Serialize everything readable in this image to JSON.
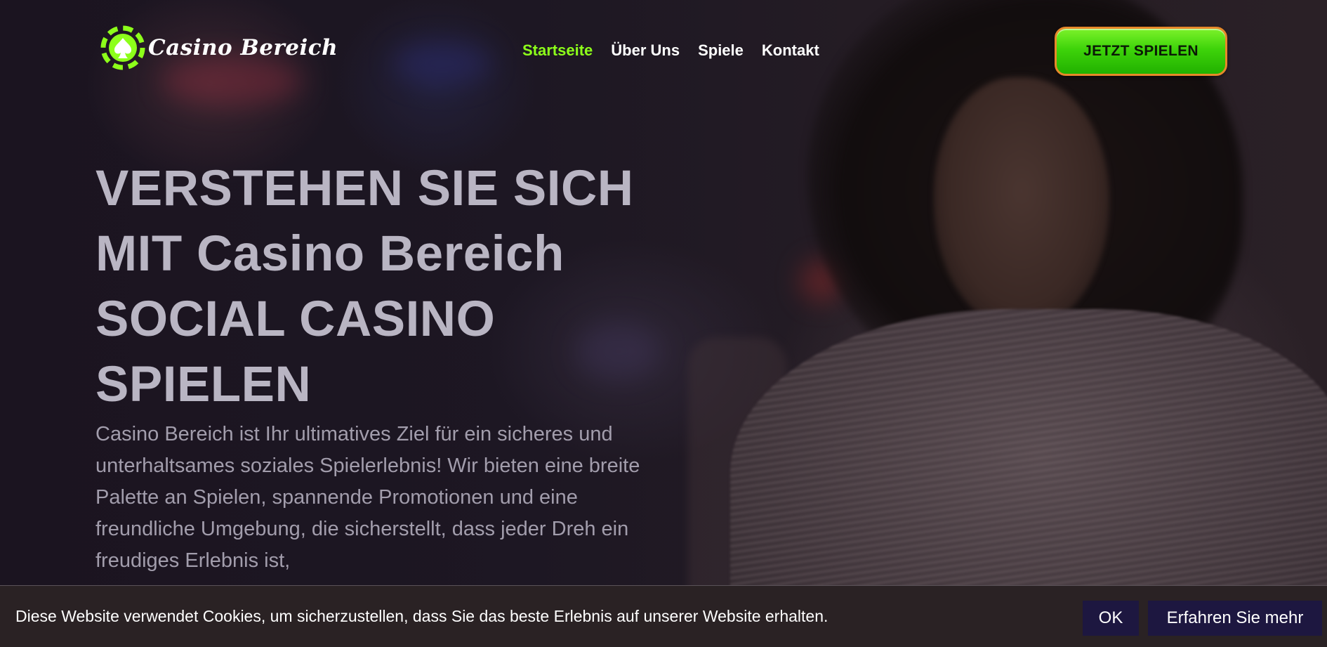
{
  "header": {
    "logo_text": "Casino Bereich",
    "nav": [
      {
        "label": "Startseite",
        "active": true
      },
      {
        "label": "Über Uns",
        "active": false
      },
      {
        "label": "Spiele",
        "active": false
      },
      {
        "label": "Kontakt",
        "active": false
      }
    ],
    "cta_label": "JETZT SPIELEN"
  },
  "hero": {
    "title_lines": [
      "VERSTEHEN SIE SICH",
      "MIT Casino Bereich",
      "SOCIAL CASINO",
      "SPIELEN"
    ],
    "text": "Casino Bereich ist Ihr ultimatives Ziel für ein sicheres und unterhaltsames soziales Spielerlebnis! Wir bieten eine breite Palette an Spielen, spannende Promotionen und eine freundliche Umgebung, die sicherstellt, dass jeder Dreh ein freudiges Erlebnis ist,"
  },
  "cookie": {
    "text": "Diese Website verwendet Cookies, um sicherzustellen, dass Sie das beste Erlebnis auf unserer Website erhalten.",
    "ok_label": "OK",
    "more_label": "Erfahren Sie mehr"
  },
  "colors": {
    "accent_green": "#8dff1a",
    "cta_border": "#e7892a",
    "cookie_button_bg": "#1d1740"
  },
  "icons": {
    "logo": "poker-chip-spade-icon"
  }
}
